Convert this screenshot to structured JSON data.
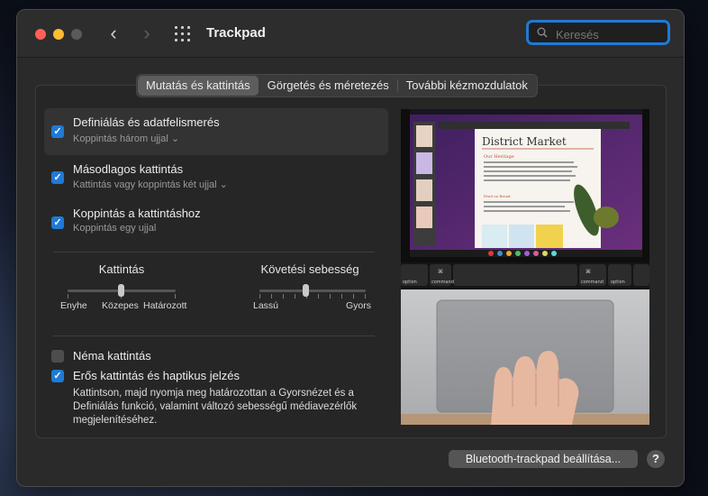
{
  "window": {
    "title": "Trackpad",
    "search": {
      "placeholder": "Keresés",
      "value": ""
    }
  },
  "tabs": [
    {
      "label": "Mutatás és kattintás",
      "active": true
    },
    {
      "label": "Görgetés és méretezés",
      "active": false
    },
    {
      "label": "További kézmozdulatok",
      "active": false
    }
  ],
  "options": [
    {
      "label": "Definiálás és adatfelismerés",
      "sub": "Koppintás három ujjal",
      "checked": true,
      "has_menu": true
    },
    {
      "label": "Másodlagos kattintás",
      "sub": "Kattintás vagy koppintás két ujjal",
      "checked": true,
      "has_menu": true
    },
    {
      "label": "Koppintás a kattintáshoz",
      "sub": "Koppintás egy ujjal",
      "checked": true,
      "has_menu": false
    }
  ],
  "sliders": {
    "click": {
      "title": "Kattintás",
      "labels": [
        "Enyhe",
        "Közepes",
        "Határozott"
      ],
      "value": "Közepes"
    },
    "tracking": {
      "title": "Követési sebesség",
      "min_label": "Lassú",
      "max_label": "Gyors",
      "value": 0.5
    }
  },
  "bottom_options": [
    {
      "label": "Néma kattintás",
      "checked": false
    },
    {
      "label": "Erős kattintás és haptikus jelzés",
      "checked": true
    }
  ],
  "force_click_desc": "Kattintson, majd nyomja meg határozottan a Gyorsnézet és a Definiálás funkció, valamint változó sebességű médiavezérlők megjelenítéséhez.",
  "preview": {
    "doc_title": "District Market",
    "doc_heading": "Our Heritage",
    "doc_subheading": "Feed on Bread",
    "key_left_top": "⌘",
    "key_left": "command",
    "key_option_left": "option",
    "key_right_top": "⌘",
    "key_right": "command",
    "key_option_right": "option"
  },
  "footer": {
    "bluetooth_button": "Bluetooth-trackpad beállítása...",
    "help": "?"
  },
  "colors": {
    "accent": "#1f7ad6",
    "window_bg": "#2a2a2a"
  }
}
